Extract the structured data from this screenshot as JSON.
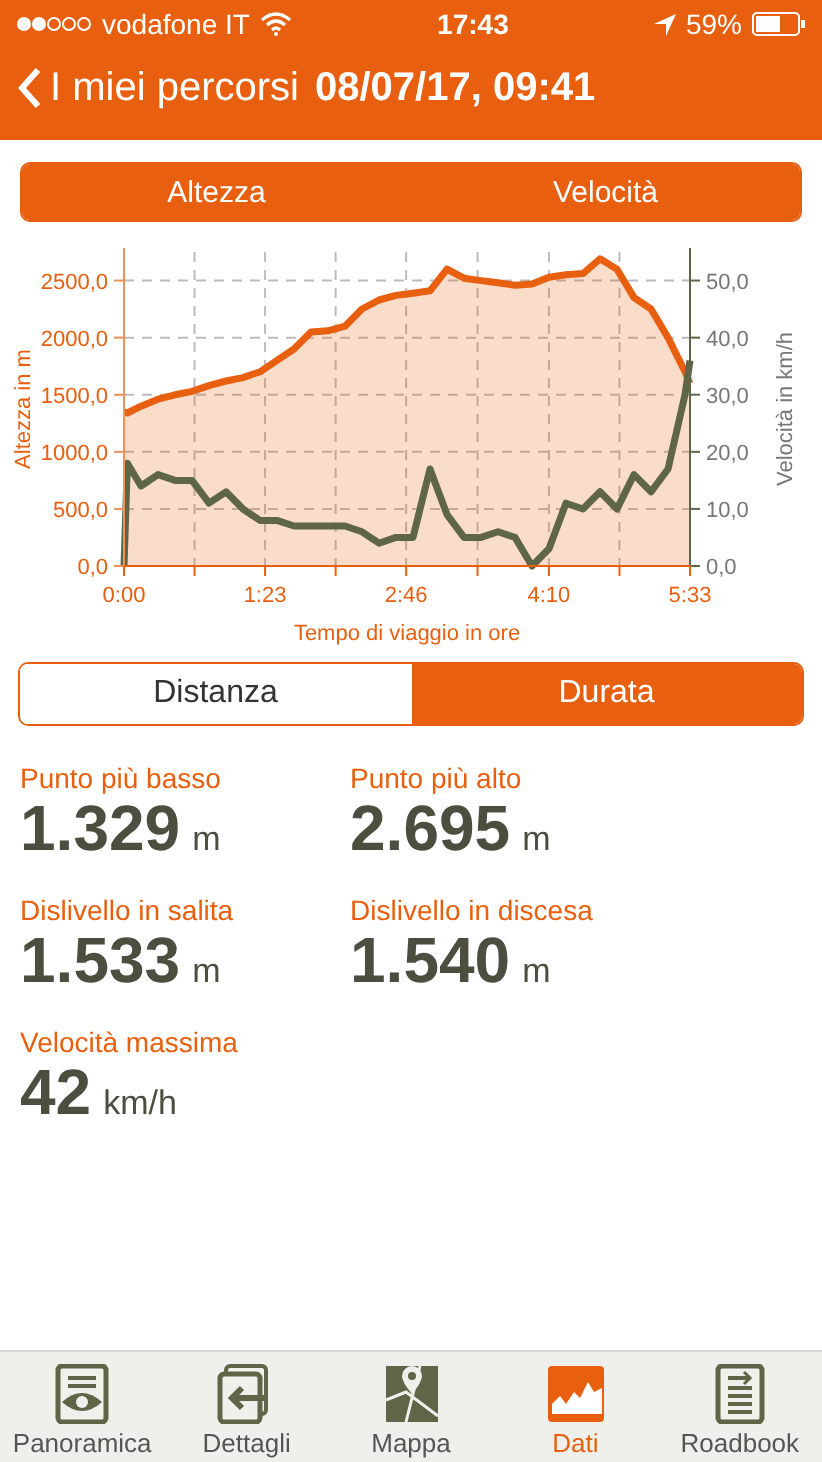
{
  "status_bar": {
    "carrier": "vodafone IT",
    "time": "17:43",
    "battery": "59%"
  },
  "nav": {
    "back": "I miei percorsi",
    "title": "08/07/17, 09:41"
  },
  "series_toggles": [
    {
      "on": true
    },
    {
      "on": true
    }
  ],
  "chart": {
    "chart_data": {
      "type": "line",
      "grid": true,
      "xlabel": "Tempo di viaggio in ore",
      "ylabel": "Altezza in m",
      "y2label": "Velocità in km/h",
      "xlim": [
        0,
        333
      ],
      "ylim": [
        0,
        2750
      ],
      "y2lim": [
        0,
        55
      ],
      "xticks": [
        {
          "value": 0,
          "label": "0:00"
        },
        {
          "value": 83,
          "label": "1:23"
        },
        {
          "value": 166,
          "label": "2:46"
        },
        {
          "value": 250,
          "label": "4:10"
        },
        {
          "value": 333,
          "label": "5:33"
        }
      ],
      "yticks": [
        {
          "value": 0,
          "label": "0,0"
        },
        {
          "value": 500,
          "label": "500,0"
        },
        {
          "value": 1000,
          "label": "1000,0"
        },
        {
          "value": 1500,
          "label": "1500,0"
        },
        {
          "value": 2000,
          "label": "2000,0"
        },
        {
          "value": 2500,
          "label": "2500,0"
        }
      ],
      "y2ticks": [
        {
          "value": 0,
          "label": "0,0"
        },
        {
          "value": 10,
          "label": "10,0"
        },
        {
          "value": 20,
          "label": "20,0"
        },
        {
          "value": 30,
          "label": "30,0"
        },
        {
          "value": 40,
          "label": "40,0"
        },
        {
          "value": 50,
          "label": "50,0"
        }
      ],
      "x": [
        0,
        2,
        10,
        20,
        30,
        40,
        50,
        60,
        70,
        80,
        90,
        100,
        110,
        120,
        130,
        140,
        150,
        160,
        170,
        180,
        190,
        200,
        210,
        220,
        230,
        240,
        250,
        260,
        270,
        280,
        290,
        300,
        310,
        320,
        330,
        333
      ],
      "series": [
        {
          "name": "Altezza",
          "color": "#e8600f",
          "type": "area",
          "values": [
            1350,
            1340,
            1400,
            1460,
            1500,
            1530,
            1580,
            1620,
            1650,
            1700,
            1800,
            1900,
            2050,
            2060,
            2100,
            2250,
            2330,
            2370,
            2390,
            2410,
            2600,
            2520,
            2500,
            2480,
            2460,
            2470,
            2530,
            2550,
            2560,
            2690,
            2600,
            2350,
            2250,
            2000,
            1700,
            1600
          ]
        },
        {
          "name": "Velocità",
          "color": "#5f6647",
          "type": "line",
          "axis": "y2",
          "values": [
            0,
            18,
            14,
            16,
            15,
            15,
            11,
            13,
            10,
            8,
            8,
            7,
            7,
            7,
            7,
            6,
            4,
            5,
            5,
            17,
            9,
            5,
            5,
            6,
            5,
            0,
            3,
            11,
            10,
            13,
            10,
            16,
            13,
            17,
            30,
            36
          ]
        }
      ]
    }
  },
  "basis": [
    {
      "label": "Distanza",
      "selected": false
    },
    {
      "label": "Durata",
      "selected": true
    }
  ],
  "stats": [
    {
      "label": "Punto più basso",
      "value": "1.329",
      "unit": "m"
    },
    {
      "label": "Punto più alto",
      "value": "2.695",
      "unit": "m"
    },
    {
      "label": "Dislivello in salita",
      "value": "1.533",
      "unit": "m"
    },
    {
      "label": "Dislivello in discesa",
      "value": "1.540",
      "unit": "m"
    },
    {
      "label": "Velocità massima",
      "value": "42",
      "unit": "km/h"
    }
  ],
  "tab_bar": [
    {
      "label": "Panoramica",
      "kind": "overview",
      "selected": false
    },
    {
      "label": "Dettagli",
      "kind": "details",
      "selected": false
    },
    {
      "label": "Mappa",
      "kind": "map",
      "selected": false
    },
    {
      "label": "Dati",
      "kind": "data",
      "selected": true
    },
    {
      "label": "Roadbook",
      "kind": "roadbook",
      "selected": false
    }
  ]
}
